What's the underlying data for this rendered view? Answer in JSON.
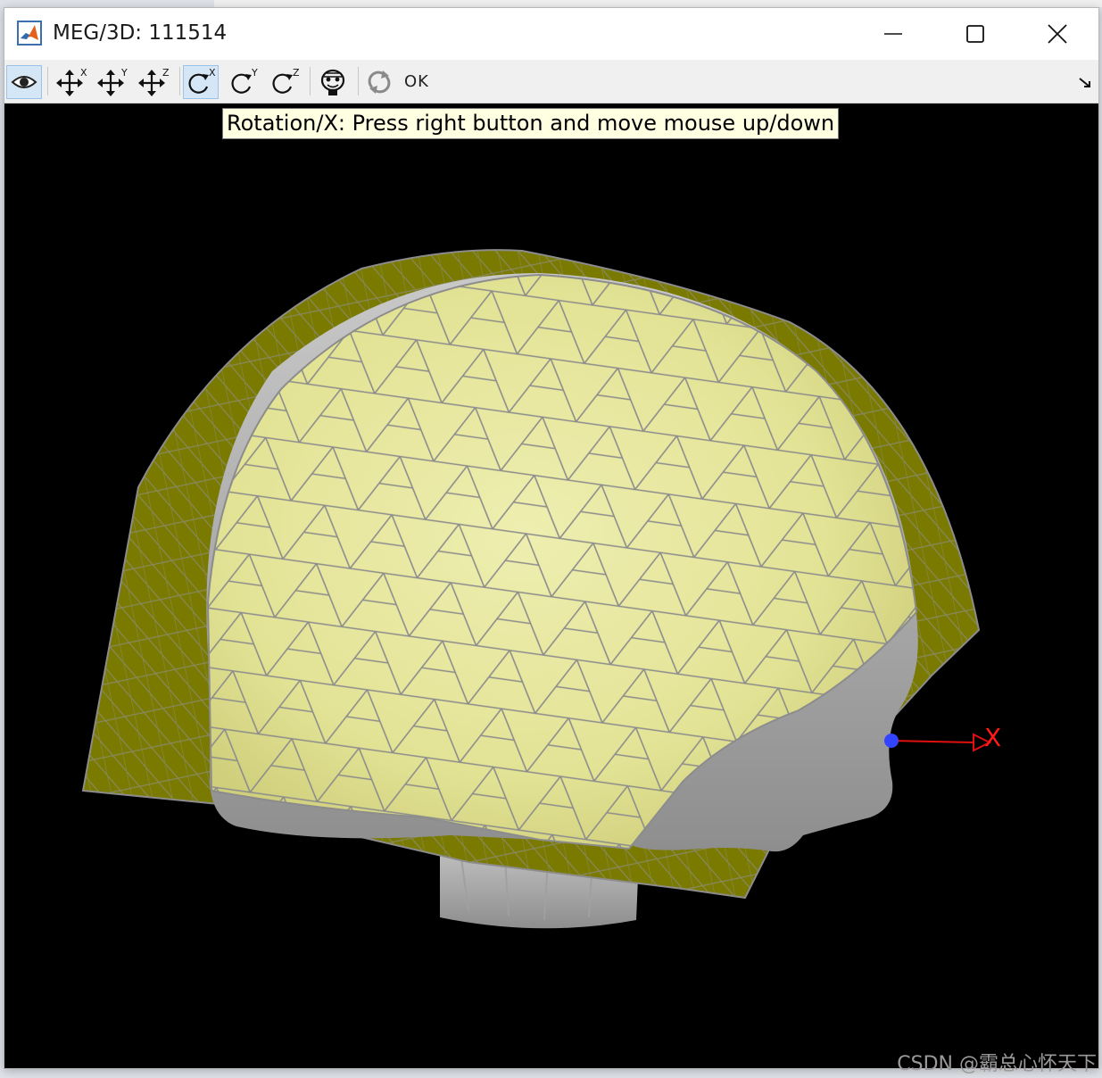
{
  "window": {
    "title": "MEG/3D: 111514",
    "icon": "matlab-logo-icon",
    "controls": [
      "minimize-icon",
      "maximize-icon",
      "close-icon"
    ]
  },
  "toolbar": {
    "buttons": [
      {
        "icon": "eye-icon",
        "state": "active"
      },
      {
        "icon": "move-x-icon",
        "superscript": "X"
      },
      {
        "icon": "move-y-icon",
        "superscript": "Y"
      },
      {
        "icon": "move-z-icon",
        "superscript": "Z"
      },
      {
        "icon": "rotate-x-icon",
        "superscript": "X",
        "state": "hover"
      },
      {
        "icon": "rotate-y-icon",
        "superscript": "Y"
      },
      {
        "icon": "rotate-z-icon",
        "superscript": "Z"
      },
      {
        "icon": "head-icon"
      },
      {
        "icon": "reset-icon"
      }
    ],
    "ok_label": "OK"
  },
  "tooltip": {
    "text": "Rotation/X: Press right button and move mouse up/down"
  },
  "viewer": {
    "background_color": "#000000",
    "helmet_color": "#7a7a00",
    "scalp_fill_color": "#e5e598",
    "mesh_line_color": "#8c8c8c",
    "head_color": "#b5b5b5",
    "axis": {
      "label": "X",
      "color": "#ff1a1a"
    }
  },
  "watermark": "CSDN @霸总心怀天下"
}
